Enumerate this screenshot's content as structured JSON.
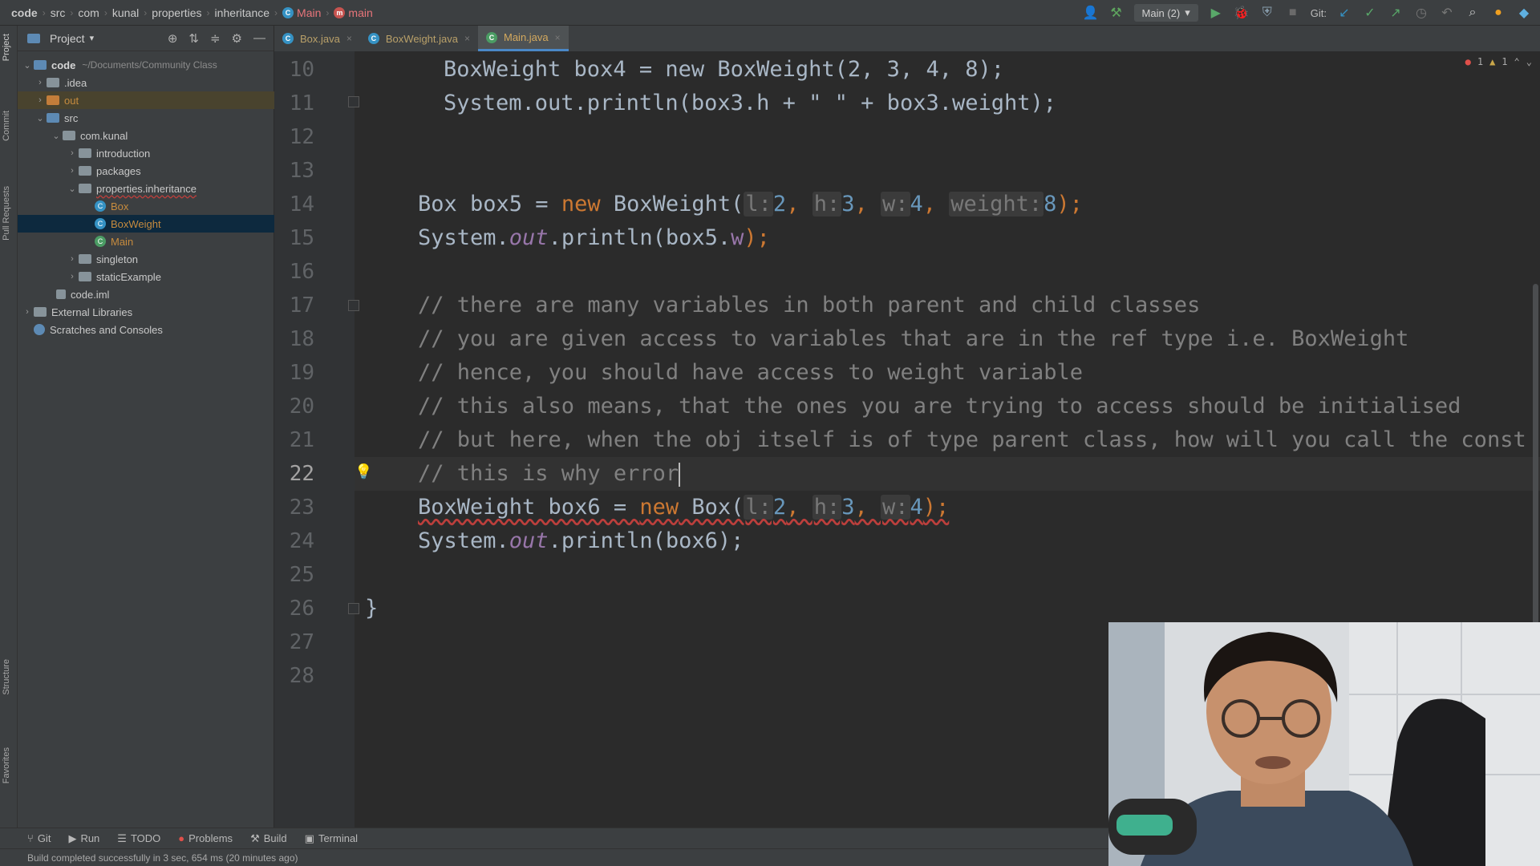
{
  "breadcrumb": {
    "items": [
      "code",
      "src",
      "com",
      "kunal",
      "properties",
      "inheritance"
    ],
    "class_crumb": "Main",
    "method_crumb": "main"
  },
  "toolbar": {
    "run_config": "Main (2)",
    "git_label": "Git:"
  },
  "project_panel": {
    "title": "Project",
    "root_name": "code",
    "root_path": "~/Documents/Community Class",
    "tree": [
      {
        "label": ".idea",
        "kind": "folder"
      },
      {
        "label": "out",
        "kind": "folder-orange"
      },
      {
        "label": "src",
        "kind": "folder-blue"
      },
      {
        "label": "com.kunal",
        "kind": "package"
      },
      {
        "label": "introduction",
        "kind": "package"
      },
      {
        "label": "packages",
        "kind": "package"
      },
      {
        "label": "properties.inheritance",
        "kind": "package"
      },
      {
        "label": "Box",
        "kind": "class"
      },
      {
        "label": "BoxWeight",
        "kind": "class"
      },
      {
        "label": "Main",
        "kind": "class-run"
      },
      {
        "label": "singleton",
        "kind": "package"
      },
      {
        "label": "staticExample",
        "kind": "package"
      },
      {
        "label": "code.iml",
        "kind": "file"
      },
      {
        "label": "External Libraries",
        "kind": "lib"
      },
      {
        "label": "Scratches and Consoles",
        "kind": "scratch"
      }
    ]
  },
  "left_strip": {
    "project": "Project",
    "commit": "Commit",
    "pull_requests": "Pull Requests",
    "structure": "Structure",
    "favorites": "Favorites"
  },
  "tabs": [
    {
      "label": "Box.java",
      "active": false
    },
    {
      "label": "BoxWeight.java",
      "active": false
    },
    {
      "label": "Main.java",
      "active": true
    }
  ],
  "editor": {
    "line_numbers": [
      "10",
      "11",
      "12",
      "13",
      "14",
      "15",
      "16",
      "17",
      "18",
      "19",
      "20",
      "21",
      "22",
      "23",
      "24",
      "25",
      "26",
      "27",
      "28"
    ],
    "current_line": "22",
    "error_count": "1",
    "warning_count": "1",
    "lines": {
      "l10": "BoxWeight box4 = new BoxWeight(2, 3, 4, 8);",
      "l11": "System.out.println(box3.h + \" \" + box3.weight);",
      "l14_a": "Box box5 = ",
      "l14_new": "new",
      "l14_b": " BoxWeight(",
      "l14_h1": "l:",
      "l14_v1": "2",
      "l14_h2": "h:",
      "l14_v2": "3",
      "l14_h3": "w:",
      "l14_v3": "4",
      "l14_h4": "weight:",
      "l14_v4": "8",
      "l15_a": "System.",
      "l15_out": "out",
      "l15_b": ".println(box5.",
      "l15_w": "w",
      "l15_c": ");",
      "l17": "// there are many variables in both parent and child classes",
      "l18": "// you are given access to variables that are in the ref type i.e. BoxWeight",
      "l19": "// hence, you should have access to weight variable",
      "l20": "// this also means, that the ones you are trying to access should be initialised",
      "l21": "// but here, when the obj itself is of type parent class, how will you call the const",
      "l22": "// this is why error",
      "l23_a": "BoxWeight box6 = ",
      "l23_new": "new",
      "l23_b": " Box(",
      "l23_h1": "l:",
      "l23_v1": "2",
      "l23_h2": "h:",
      "l23_v2": "3",
      "l23_h3": "w:",
      "l23_v3": "4",
      "l23_c": ");",
      "l24_a": "System.",
      "l24_out": "out",
      "l24_b": ".println(box6);",
      "l26": "}"
    }
  },
  "bottom_tools": [
    "Git",
    "Run",
    "TODO",
    "Problems",
    "Build",
    "Terminal"
  ],
  "status": "Build completed successfully in 3 sec, 654 ms (20 minutes ago)"
}
